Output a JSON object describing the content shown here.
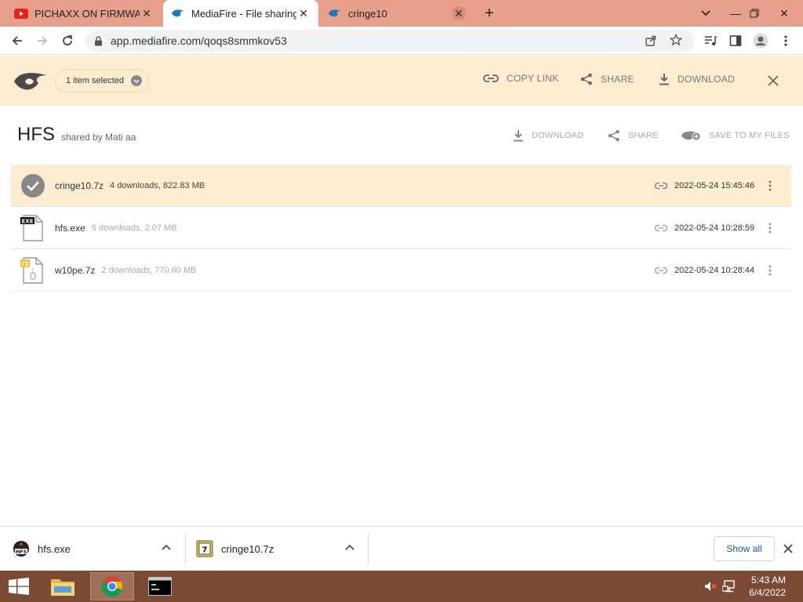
{
  "browser": {
    "tabs": [
      {
        "title": "PICHAXX ON FIRMWARE",
        "icon": "youtube-icon"
      },
      {
        "title": "MediaFire - File sharing a",
        "icon": "mediafire-icon"
      },
      {
        "title": "cringe10",
        "icon": "mediafire-icon"
      }
    ],
    "url": "app.mediafire.com/qoqs8smmkov53"
  },
  "actionbar": {
    "selection_label": "1 item selected",
    "copy_link": "COPY LINK",
    "share": "SHARE",
    "download": "DOWNLOAD"
  },
  "folder": {
    "name": "HFS",
    "shared_by": "shared by Mati aa",
    "download": "DOWNLOAD",
    "share": "SHARE",
    "save": "SAVE TO MY FILES"
  },
  "files": [
    {
      "name": "cringe10.7z",
      "meta": "4 downloads, 822.83 MB",
      "date": "2022-05-24 15:45:46",
      "selected": true
    },
    {
      "name": "hfs.exe",
      "meta": "5 downloads, 2.07 MB",
      "date": "2022-05-24 10:28:59",
      "selected": false
    },
    {
      "name": "w10pe.7z",
      "meta": "2 downloads, 770.60 MB",
      "date": "2022-05-24 10:28:44",
      "selected": false
    }
  ],
  "downloads": {
    "items": [
      {
        "name": "hfs.exe"
      },
      {
        "name": "cringe10.7z"
      }
    ],
    "show_all": "Show all"
  },
  "taskbar": {
    "time": "5:43 AM",
    "date": "6/4/2022"
  },
  "colors": {
    "accent_bg": "#fdedd0",
    "tabstrip": "#e8a08c",
    "taskbar": "#7a4a35",
    "link_blue": "#1a5aa8"
  }
}
